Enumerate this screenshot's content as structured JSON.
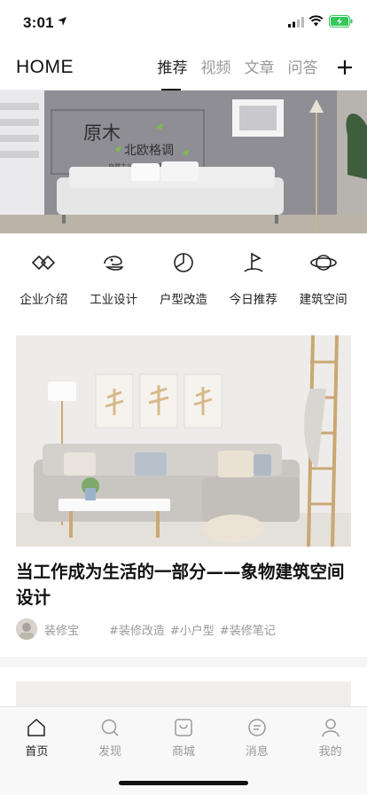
{
  "status_bar": {
    "time": "3:01"
  },
  "header": {
    "brand": "HOME",
    "tabs": [
      {
        "label": "推荐",
        "active": true
      },
      {
        "label": "视频",
        "active": false
      },
      {
        "label": "文章",
        "active": false
      },
      {
        "label": "问答",
        "active": false
      }
    ],
    "add_icon": "plus-icon"
  },
  "hero": {
    "title_main": "原木",
    "title_sub": "北欧格调",
    "caption": "自然主义　返璞归真"
  },
  "categories": [
    {
      "label": "企业介绍",
      "icon": "diamond-icon"
    },
    {
      "label": "工业设计",
      "icon": "hat-icon"
    },
    {
      "label": "户型改造",
      "icon": "pie-icon"
    },
    {
      "label": "今日推荐",
      "icon": "flag-icon"
    },
    {
      "label": "建筑空间",
      "icon": "planet-icon"
    }
  ],
  "article": {
    "title": "当工作成为生活的一部分——象物建筑空间设计",
    "author": "装修宝",
    "tags": [
      "#装修改造",
      "#小户型",
      "#装修笔记"
    ]
  },
  "tabbar": {
    "items": [
      {
        "label": "首页",
        "icon": "home-icon",
        "active": true
      },
      {
        "label": "发现",
        "icon": "search-icon",
        "active": false
      },
      {
        "label": "商城",
        "icon": "shop-icon",
        "active": false
      },
      {
        "label": "消息",
        "icon": "message-icon",
        "active": false
      },
      {
        "label": "我的",
        "icon": "profile-icon",
        "active": false
      }
    ]
  },
  "colors": {
    "text": "#111111",
    "muted": "#999999",
    "accent": "#222222",
    "battery": "#34c759"
  }
}
